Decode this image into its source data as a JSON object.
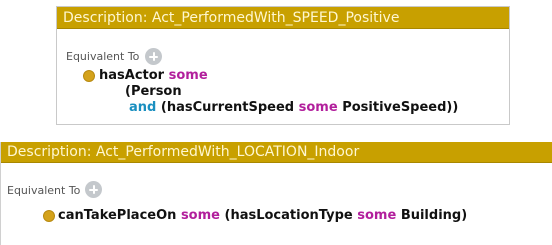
{
  "panels": [
    {
      "title": "Description: Act_PerformedWith_SPEED_Positive",
      "section_label": "Equivalent To",
      "expr": {
        "l1_prop": "hasActor",
        "l1_kw": "some",
        "l2_text": "(Person",
        "l3_and": "and",
        "l3_open": "(hasCurrentSpeed",
        "l3_kw": "some",
        "l3_close": "PositiveSpeed))"
      }
    },
    {
      "title": "Description: Act_PerformedWith_LOCATION_Indoor",
      "section_label": "Equivalent To",
      "expr": {
        "prop": "canTakePlaceOn",
        "kw1": "some",
        "mid": "(hasLocationType",
        "kw2": "some",
        "tail": "Building)"
      }
    }
  ],
  "colors": {
    "title_bg": "#c8a000",
    "title_text": "#fff7d0",
    "keyword": "#b21f9c",
    "keyword_and": "#1a8fc0",
    "bullet": "#d4a21b",
    "add_button": "#c4c8cc"
  },
  "icons": {
    "add": "add-circle-icon",
    "bullet": "class-bullet-icon"
  }
}
